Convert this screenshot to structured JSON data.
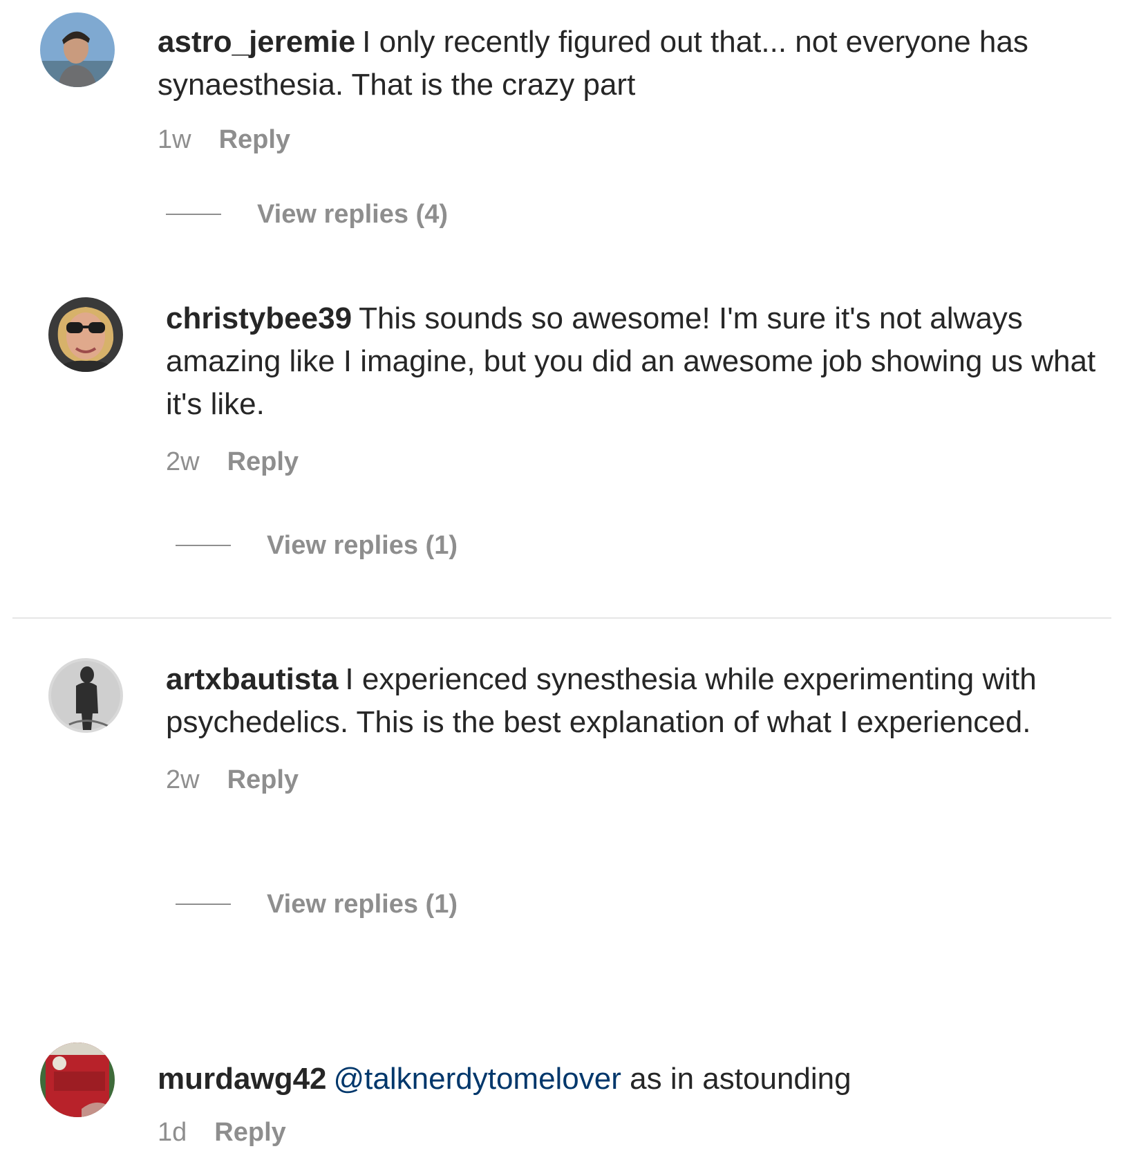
{
  "comments": [
    {
      "username": "astro_jeremie",
      "text": "I only recently figured out that... not everyone has synaesthesia. That is the crazy part",
      "time": "1w",
      "reply_label": "Reply",
      "view_replies": "View replies (4)",
      "avatar_icon": "user-avatar-photo"
    },
    {
      "username": "christybee39",
      "text": "This sounds so awesome! I'm sure it's not always amazing like I imagine, but you did an awesome job showing us what it's like.",
      "time": "2w",
      "reply_label": "Reply",
      "view_replies": "View replies (1)",
      "avatar_icon": "user-avatar-photo"
    },
    {
      "username": "artxbautista",
      "text": "I experienced synesthesia while experimenting with psychedelics. This is the best explanation of what I experienced.",
      "time": "2w",
      "reply_label": "Reply",
      "view_replies": "View replies (1)",
      "avatar_icon": "user-avatar-photo"
    },
    {
      "username": "murdawg42",
      "mention": "@talknerdytomelover",
      "text": "as in astounding",
      "time": "1d",
      "reply_label": "Reply",
      "avatar_icon": "user-avatar-photo"
    }
  ],
  "colors": {
    "text": "#262626",
    "muted": "#8e8e8e",
    "mention": "#00376b",
    "divider": "#e6e6e6",
    "background": "#ffffff"
  }
}
